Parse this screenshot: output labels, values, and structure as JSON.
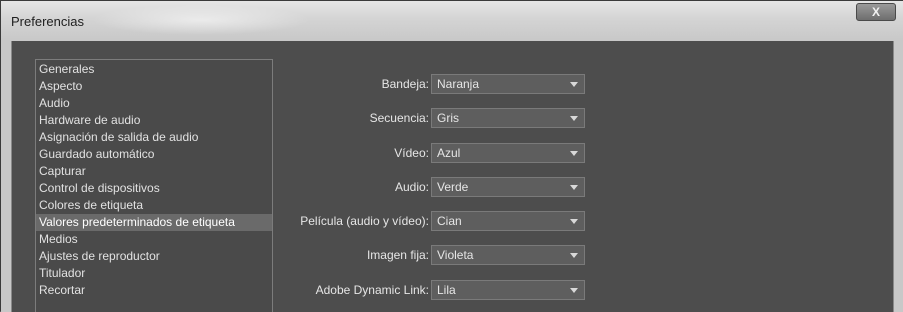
{
  "window": {
    "title": "Preferencias",
    "close_label": "X"
  },
  "sidebar": {
    "items": [
      {
        "label": "Generales",
        "selected": false
      },
      {
        "label": "Aspecto",
        "selected": false
      },
      {
        "label": "Audio",
        "selected": false
      },
      {
        "label": "Hardware de audio",
        "selected": false
      },
      {
        "label": "Asignación de salida de audio",
        "selected": false
      },
      {
        "label": "Guardado automático",
        "selected": false
      },
      {
        "label": "Capturar",
        "selected": false
      },
      {
        "label": "Control de dispositivos",
        "selected": false
      },
      {
        "label": "Colores de etiqueta",
        "selected": false
      },
      {
        "label": "Valores predeterminados de etiqueta",
        "selected": true
      },
      {
        "label": "Medios",
        "selected": false
      },
      {
        "label": "Ajustes de reproductor",
        "selected": false
      },
      {
        "label": "Titulador",
        "selected": false
      },
      {
        "label": "Recortar",
        "selected": false
      }
    ]
  },
  "form": {
    "rows": [
      {
        "label": "Bandeja:",
        "value": "Naranja"
      },
      {
        "label": "Secuencia:",
        "value": "Gris"
      },
      {
        "label": "Vídeo:",
        "value": "Azul"
      },
      {
        "label": "Audio:",
        "value": "Verde"
      },
      {
        "label": "Película (audio y vídeo):",
        "value": "Cian"
      },
      {
        "label": "Imagen fija:",
        "value": "Violeta"
      },
      {
        "label": "Adobe Dynamic Link:",
        "value": "Lila"
      }
    ]
  }
}
